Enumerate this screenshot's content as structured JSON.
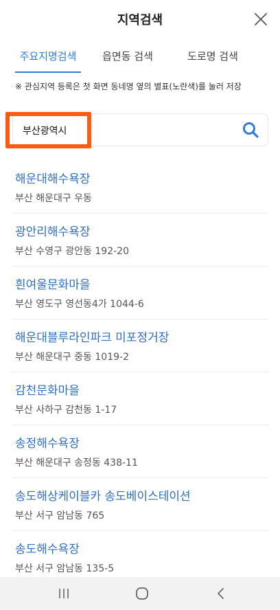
{
  "header": {
    "title": "지역검색",
    "close_icon": "close-icon"
  },
  "tabs": [
    {
      "label": "주요지명검색",
      "active": true
    },
    {
      "label": "읍면동 검색",
      "active": false
    },
    {
      "label": "도로명 검색",
      "active": false
    }
  ],
  "notice": "※ 관심지역 등록은 첫 화면 동네명 옆의 별표(노란색)를 눌러 저장",
  "search": {
    "value": "부산광역시",
    "icon": "search-icon"
  },
  "colors": {
    "accent": "#2f7bd6",
    "highlight": "#ff5a0f",
    "result_name": "#2f6fbf"
  },
  "results": [
    {
      "name": "해운대해수욕장",
      "address": "부산 해운대구 우동"
    },
    {
      "name": "광안리해수욕장",
      "address": "부산 수영구 광안동 192-20"
    },
    {
      "name": "흰여울문화마을",
      "address": "부산 영도구 영선동4가 1044-6"
    },
    {
      "name": "해운대블루라인파크 미포정거장",
      "address": "부산 해운대구 중동 1019-2"
    },
    {
      "name": "감천문화마을",
      "address": "부산 사하구 감천동 1-17"
    },
    {
      "name": "송정해수욕장",
      "address": "부산 해운대구 송정동 438-11"
    },
    {
      "name": "송도해상케이블카 송도베이스테이션",
      "address": "부산 서구 암남동 765"
    },
    {
      "name": "송도해수욕장",
      "address": "부산 서구 암남동 135-5"
    }
  ],
  "navbar": {
    "icons": [
      "recent-apps-icon",
      "home-icon",
      "back-icon"
    ]
  }
}
